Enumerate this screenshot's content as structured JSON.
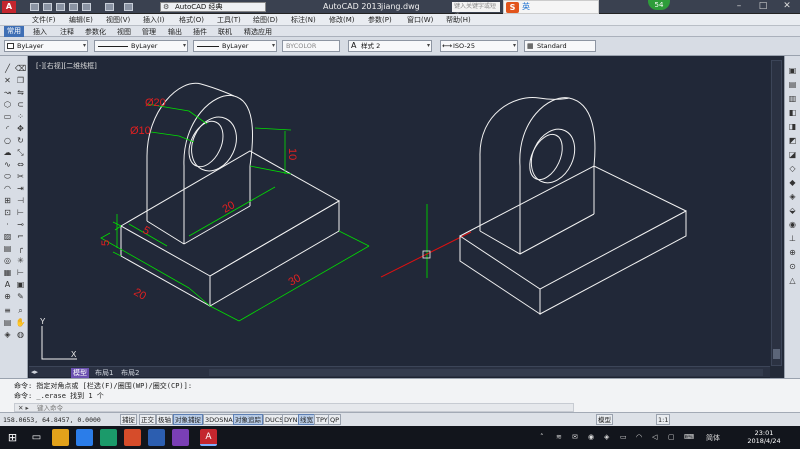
{
  "titlebar": {
    "logo_letter": "A",
    "workspace": "AutoCAD 经典",
    "app_title": "AutoCAD 2013",
    "file_title": "jiang.dwg",
    "search_placeholder": "键入关键字或短语",
    "ime_label": "英",
    "badge": "54"
  },
  "menubar": [
    "文件(F)",
    "编辑(E)",
    "视图(V)",
    "插入(I)",
    "格式(O)",
    "工具(T)",
    "绘图(D)",
    "标注(N)",
    "修改(M)",
    "参数(P)",
    "窗口(W)",
    "帮助(H)"
  ],
  "ribbon_tabs": [
    "常用",
    "插入",
    "注释",
    "参数化",
    "视图",
    "管理",
    "输出",
    "插件",
    "联机",
    "精选应用"
  ],
  "properties": {
    "layer": "ByLayer",
    "linetype": "ByLayer",
    "lineweight": "ByLayer",
    "plotstyle": "BYCOLOR",
    "text_style": "样式 2",
    "dim_style": "ISO-25",
    "table_style": "Standard"
  },
  "viewport_label": "[-][右视][二维线框]",
  "dimensions": {
    "d_outer": "Ø20",
    "d_inner": "Ø10",
    "height": "10",
    "thickness": "5",
    "upright_width": "5",
    "depth": "20",
    "base_width": "20",
    "base_length": "30"
  },
  "ucs": {
    "x": "X",
    "y": "Y"
  },
  "layout_tabs": [
    "模型",
    "布局1",
    "布局2"
  ],
  "command_lines": [
    "命令: 指定对角点或 [栏选(F)/圈围(WP)/圈交(CP)]:",
    "命令: _.erase 找到 1 个"
  ],
  "command_placeholder": "键入命令",
  "status": {
    "coords": "158.0653, 64.8457, 0.0000",
    "buttons": [
      "捕捉",
      "正交",
      "极轴",
      "对象捕捉",
      "3DOSNAP",
      "对象追踪",
      "DUCS",
      "DYN",
      "线宽",
      "TPY",
      "QP"
    ],
    "active_buttons": [
      "对象捕捉",
      "对象追踪",
      "线宽"
    ],
    "model_label": "模型",
    "scale": "1:1"
  },
  "taskbar": {
    "time": "23:01",
    "date": "2018/4/24",
    "lang": "简体"
  },
  "colors": {
    "canvas": "#212838",
    "drawing_lines": "#f2f2f2",
    "dim_lines": "#00e000",
    "dim_text": "#e02020",
    "crosshair_green": "#00c000",
    "crosshair_red": "#e01010"
  }
}
